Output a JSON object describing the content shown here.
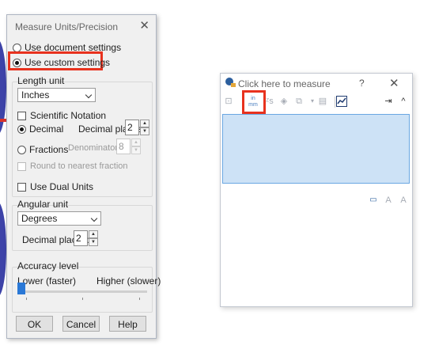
{
  "dialog": {
    "title": "Measure Units/Precision",
    "close_glyph": "✕",
    "use_document_settings": "Use document settings",
    "use_custom_settings": "Use custom settings",
    "length_unit": {
      "label": "Length unit",
      "selected": "Inches",
      "scientific_notation": "Scientific Notation",
      "decimal": "Decimal",
      "decimal_places_label": "Decimal places:",
      "decimal_places": "2",
      "fractions": "Fractions",
      "denominator_label": "Denominator:",
      "denominator": "8",
      "round_to_nearest_fraction": "Round to nearest fraction",
      "use_dual_units": "Use Dual Units"
    },
    "angular_unit": {
      "label": "Angular unit",
      "selected": "Degrees",
      "decimal_places_label": "Decimal places:",
      "decimal_places": "2"
    },
    "accuracy": {
      "label": "Accuracy level",
      "lower": "Lower (faster)",
      "higher": "Higher (slower)",
      "level": 0
    },
    "buttons": {
      "ok": "OK",
      "cancel": "Cancel",
      "help": "Help"
    }
  },
  "measure_window": {
    "title": "Click here to measure",
    "help_glyph": "?",
    "close_glyph": "✕",
    "toolbar_icons": [
      "arc-circle-measure-icon",
      "units-precision-icon",
      "show-xyz-icon",
      "point-to-point-icon",
      "projected-on-icon",
      "dropdown-icon",
      "history-icon",
      "create-sensor-icon",
      "pin-icon",
      "collapse-icon"
    ],
    "units_icon_label": "in\nmm"
  },
  "colors": {
    "highlight": "#e8321e",
    "results_fill": "#cde2f6",
    "slider_thumb": "#2a78d6"
  }
}
